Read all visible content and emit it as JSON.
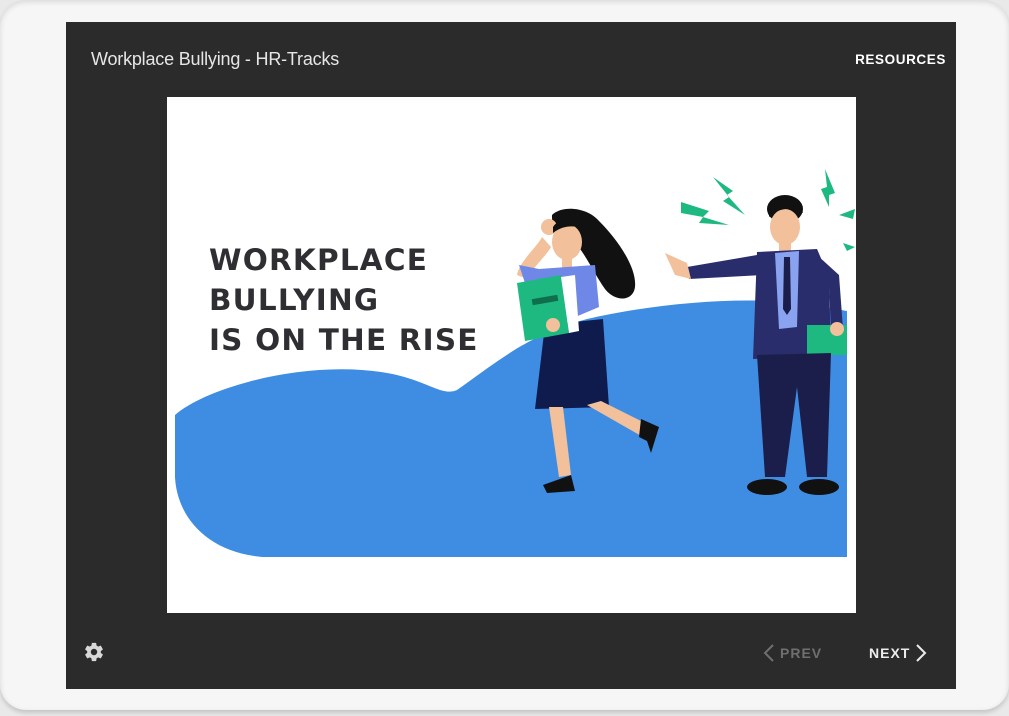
{
  "header": {
    "title": "Workplace Bullying - HR-Tracks",
    "resources_label": "RESOURCES"
  },
  "slide": {
    "heading_lines": [
      "WORKPLACE",
      "BULLYING",
      "IS ON THE RISE"
    ]
  },
  "footer": {
    "prev_label": "PREV",
    "next_label": "NEXT",
    "settings_icon": "gear-icon"
  },
  "colors": {
    "player_bg": "#2b2b2b",
    "slide_blob": "#3f8de3",
    "accent_green": "#1eb980",
    "text_dark": "#2f2f33"
  }
}
